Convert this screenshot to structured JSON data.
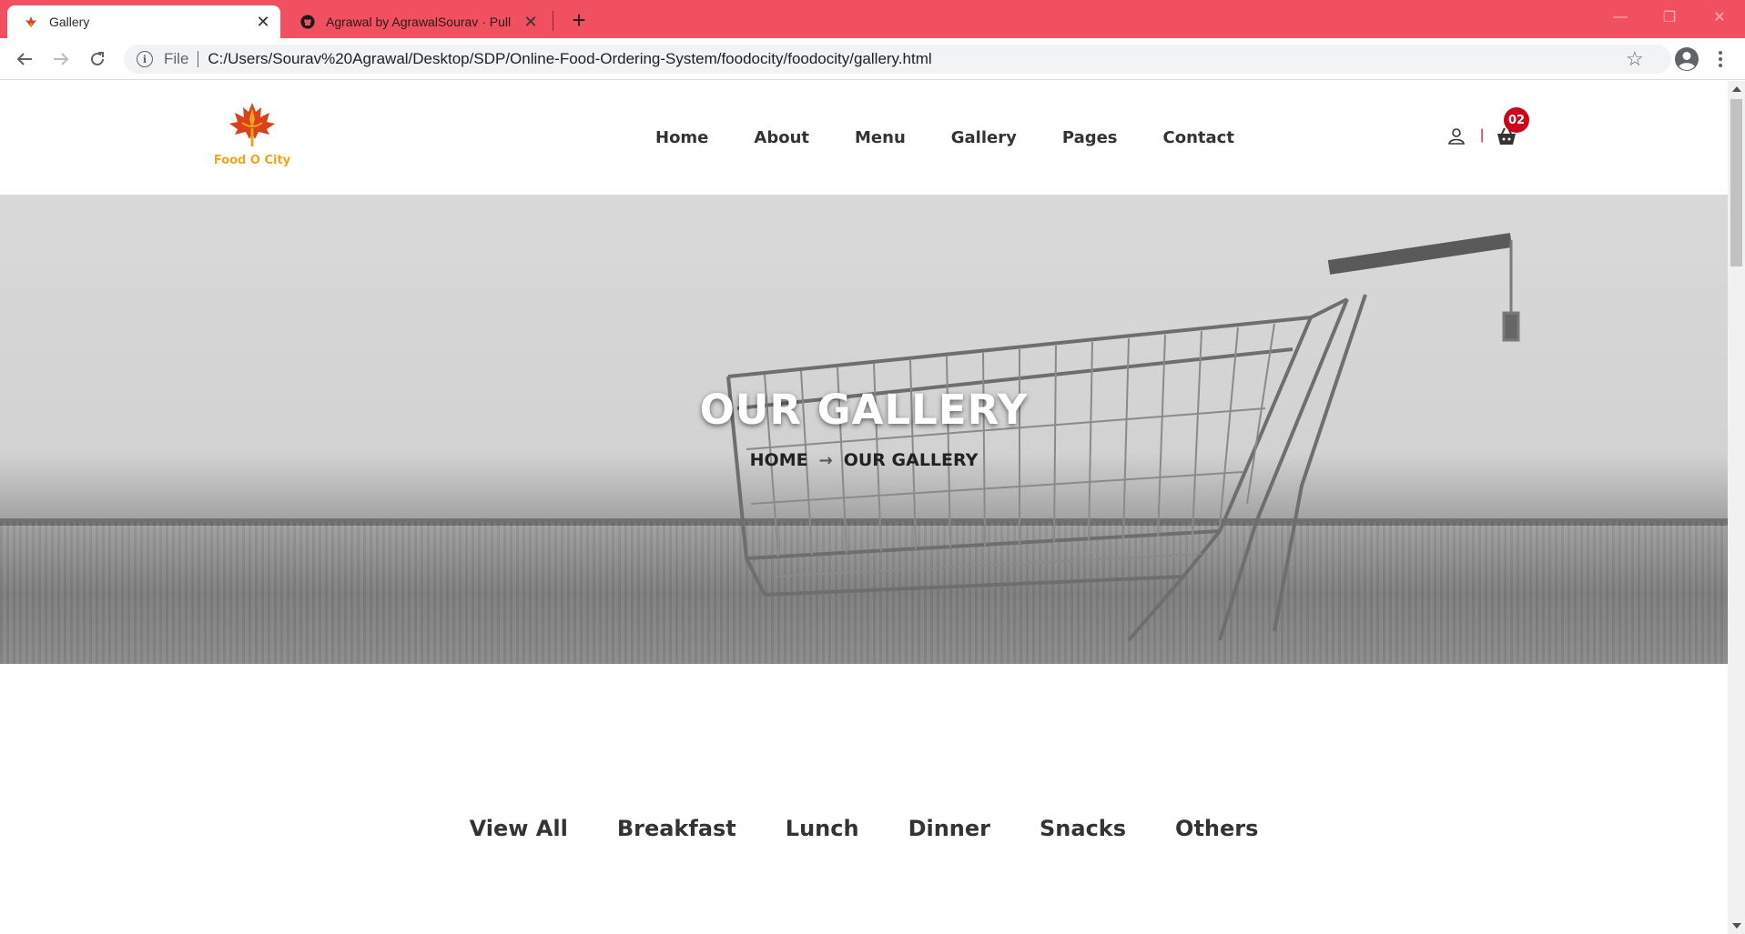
{
  "browser": {
    "tabs": [
      {
        "title": "Gallery",
        "active": true
      },
      {
        "title": "Agrawal by AgrawalSourav · Pull",
        "active": false
      }
    ],
    "address": {
      "scheme": "File",
      "url": "C:/Users/Sourav%20Agrawal/Desktop/SDP/Online-Food-Ordering-System/foodocity/foodocity/gallery.html"
    },
    "colors": {
      "tabbar": "#f0505f"
    }
  },
  "site": {
    "logo_text": "Food O City",
    "nav": [
      "Home",
      "About",
      "Menu",
      "Gallery",
      "Pages",
      "Contact"
    ],
    "cart_count": "02",
    "header_divider": "|"
  },
  "hero": {
    "title": "OUR GALLERY",
    "breadcrumb": {
      "home": "HOME",
      "arrow": "→",
      "current": "OUR GALLERY"
    }
  },
  "gallery": {
    "filters": [
      "View All",
      "Breakfast",
      "Lunch",
      "Dinner",
      "Snacks",
      "Others"
    ]
  },
  "icons": [
    "favicon-icon",
    "github-icon",
    "close-icon",
    "plus-icon",
    "back-icon",
    "forward-icon",
    "reload-icon",
    "info-icon",
    "star-icon",
    "profile-icon",
    "menu-icon",
    "user-icon",
    "cart-icon"
  ]
}
